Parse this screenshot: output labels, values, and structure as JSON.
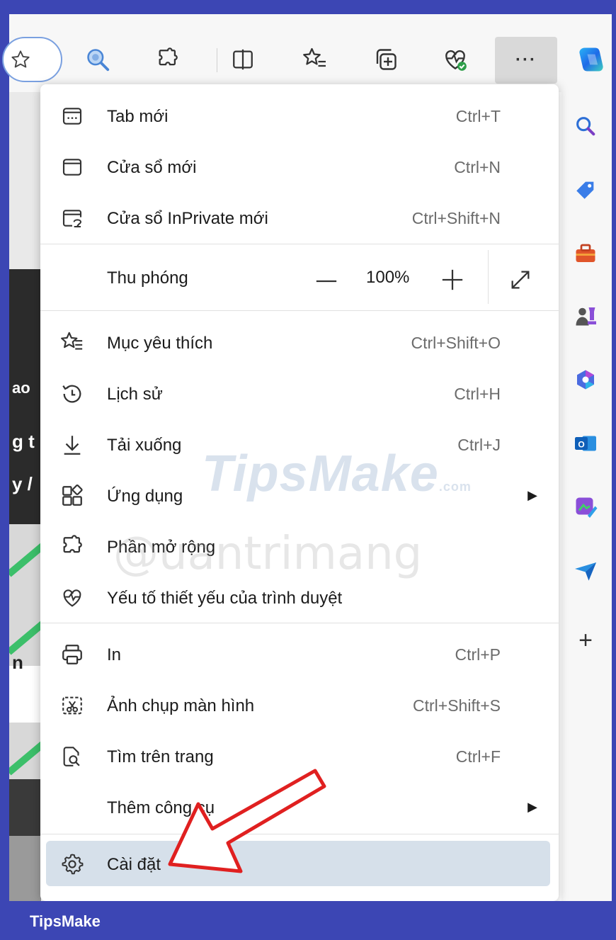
{
  "toolbar": {
    "more_label": "···",
    "icons": [
      "favorite-star-icon",
      "visual-search-icon",
      "extensions-icon",
      "split-screen-icon",
      "favorites-icon",
      "collections-icon",
      "browser-essentials-icon",
      "copilot-icon"
    ]
  },
  "menu": {
    "new_tab": {
      "label": "Tab mới",
      "shortcut": "Ctrl+T"
    },
    "new_window": {
      "label": "Cửa sổ mới",
      "shortcut": "Ctrl+N"
    },
    "new_inprivate": {
      "label": "Cửa sổ InPrivate mới",
      "shortcut": "Ctrl+Shift+N"
    },
    "zoom": {
      "label": "Thu phóng",
      "value": "100%",
      "minus": "—",
      "plus": "+"
    },
    "favorites": {
      "label": "Mục yêu thích",
      "shortcut": "Ctrl+Shift+O"
    },
    "history": {
      "label": "Lịch sử",
      "shortcut": "Ctrl+H"
    },
    "downloads": {
      "label": "Tải xuống",
      "shortcut": "Ctrl+J"
    },
    "apps": {
      "label": "Ứng dụng",
      "arrow": "▶"
    },
    "extensions": {
      "label": "Phần mở rộng"
    },
    "essentials": {
      "label": "Yếu tố thiết yếu của trình duyệt"
    },
    "print": {
      "label": "In",
      "shortcut": "Ctrl+P"
    },
    "screenshot": {
      "label": "Ảnh chụp màn hình",
      "shortcut": "Ctrl+Shift+S"
    },
    "find": {
      "label": "Tìm trên trang",
      "shortcut": "Ctrl+F"
    },
    "more_tools": {
      "label": "Thêm công cụ",
      "arrow": "▶"
    },
    "settings": {
      "label": "Cài đặt"
    }
  },
  "sidebar": {
    "icons": [
      "search-icon",
      "shopping-tag-icon",
      "tools-icon",
      "games-icon",
      "microsoft365-icon",
      "outlook-icon",
      "designer-icon",
      "drop-icon",
      "add-icon"
    ],
    "add_label": "+"
  },
  "background": {
    "snippets": [
      "ao",
      "g t",
      "y /",
      "n"
    ]
  },
  "watermarks": {
    "tipsmake": "TipsMake",
    "tipsmake_suffix": ".com",
    "quantrimang": "@uantrimang"
  },
  "footer": {
    "brand": "TipsMake"
  },
  "colors": {
    "frame": "#3c46b4",
    "highlight": "#d6e0ea",
    "arrow": "#e02020",
    "copilot_gradient": "#1f8cf0"
  }
}
